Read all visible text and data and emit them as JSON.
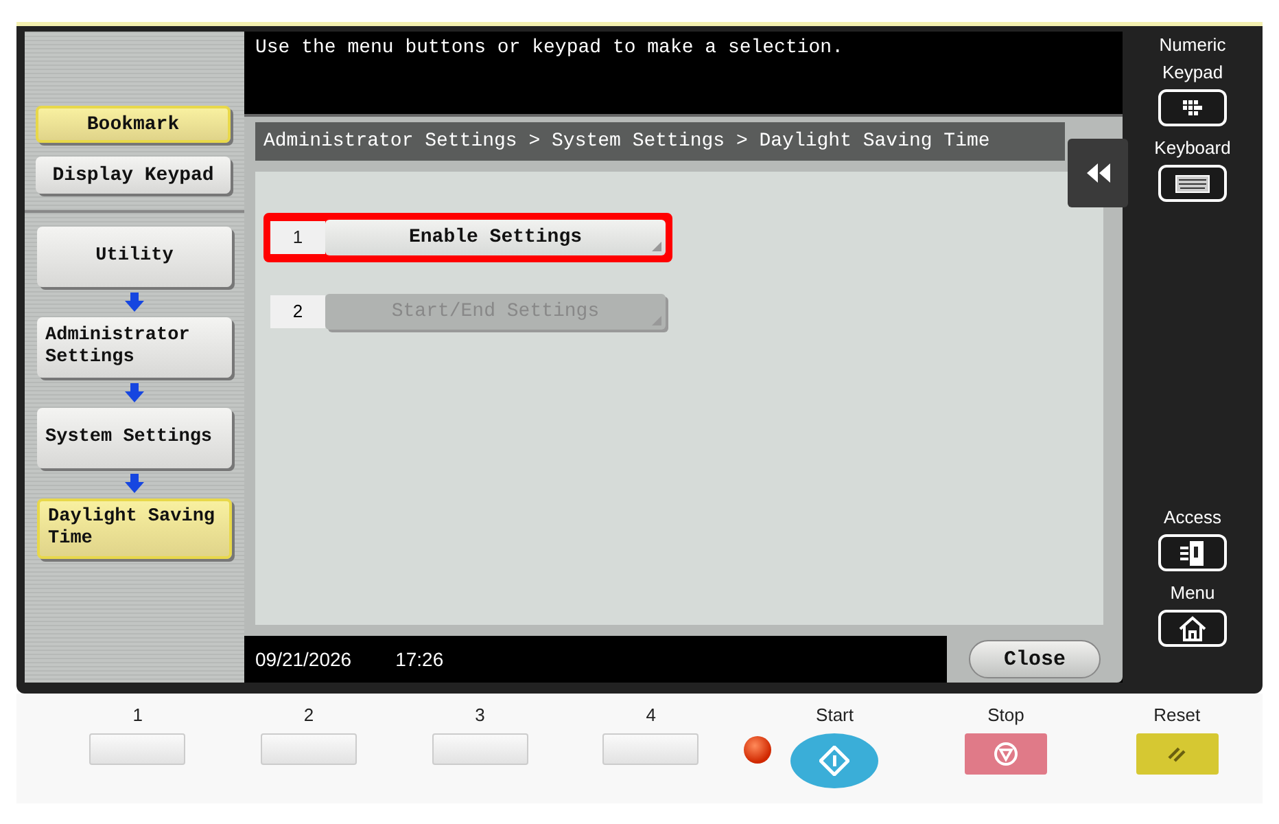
{
  "message": "Use the menu buttons or keypad to make a selection.",
  "shortcuts": [
    {
      "label": "Bookmark",
      "selected": true
    },
    {
      "label": "Display Keypad",
      "selected": false
    }
  ],
  "path": [
    {
      "label": "Utility",
      "selected": false
    },
    {
      "label": "Administrator Settings",
      "selected": false
    },
    {
      "label": "System Settings",
      "selected": false
    },
    {
      "label": "Daylight Saving Time",
      "selected": true
    }
  ],
  "breadcrumb": "Administrator Settings > System Settings > Daylight Saving Time",
  "options": [
    {
      "number": "1",
      "label": "Enable Settings",
      "highlighted": true,
      "disabled": false
    },
    {
      "number": "2",
      "label": "Start/End Settings",
      "highlighted": false,
      "disabled": true
    }
  ],
  "status_bar": {
    "date": "09/21/2026",
    "time": "17:26"
  },
  "close_button": "Close",
  "side_keys_top": [
    {
      "label": "Numeric Keypad",
      "kind": "keypad"
    },
    {
      "label": "Keyboard",
      "kind": "keyboard"
    }
  ],
  "side_keys_bottom": [
    {
      "label": "Access",
      "kind": "access"
    },
    {
      "label": "Menu",
      "kind": "home"
    }
  ],
  "function_keys": [
    "1",
    "2",
    "3",
    "4"
  ],
  "hard_keys": [
    {
      "label": "Start",
      "kind": "start"
    },
    {
      "label": "Stop",
      "kind": "stop"
    },
    {
      "label": "Reset",
      "kind": "reset"
    }
  ]
}
